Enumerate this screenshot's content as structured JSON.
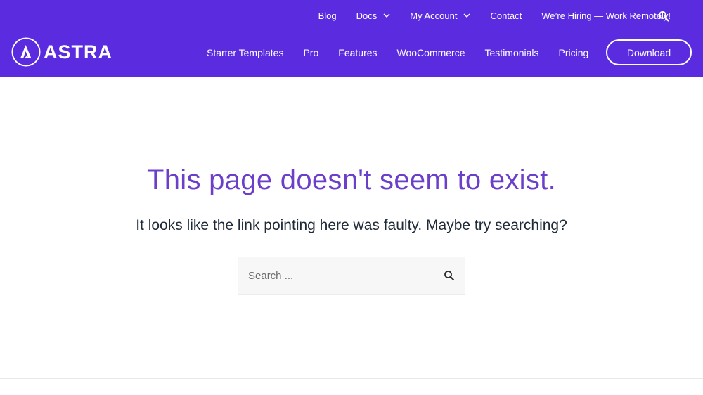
{
  "colors": {
    "header_bg": "#5b2be0",
    "headline": "#6b3fc9",
    "subline": "#1f2a37"
  },
  "brand": {
    "logo_text": "ASTRA",
    "logo_icon": "astra-logo-icon"
  },
  "top_nav": {
    "items": [
      {
        "label": "Blog",
        "has_dropdown": false
      },
      {
        "label": "Docs",
        "has_dropdown": true
      },
      {
        "label": "My Account",
        "has_dropdown": true
      },
      {
        "label": "Contact",
        "has_dropdown": false
      },
      {
        "label": "We’re Hiring — Work Remotely!",
        "has_dropdown": false
      }
    ],
    "search_icon": "search-icon"
  },
  "main_nav": {
    "items": [
      {
        "label": "Starter Templates"
      },
      {
        "label": "Pro"
      },
      {
        "label": "Features"
      },
      {
        "label": "WooCommerce"
      },
      {
        "label": "Testimonials"
      },
      {
        "label": "Pricing"
      }
    ],
    "download_label": "Download"
  },
  "content": {
    "headline": "This page doesn't seem to exist.",
    "subline": "It looks like the link pointing here was faulty. Maybe try searching?",
    "search_placeholder": "Search ...",
    "search_value": ""
  }
}
